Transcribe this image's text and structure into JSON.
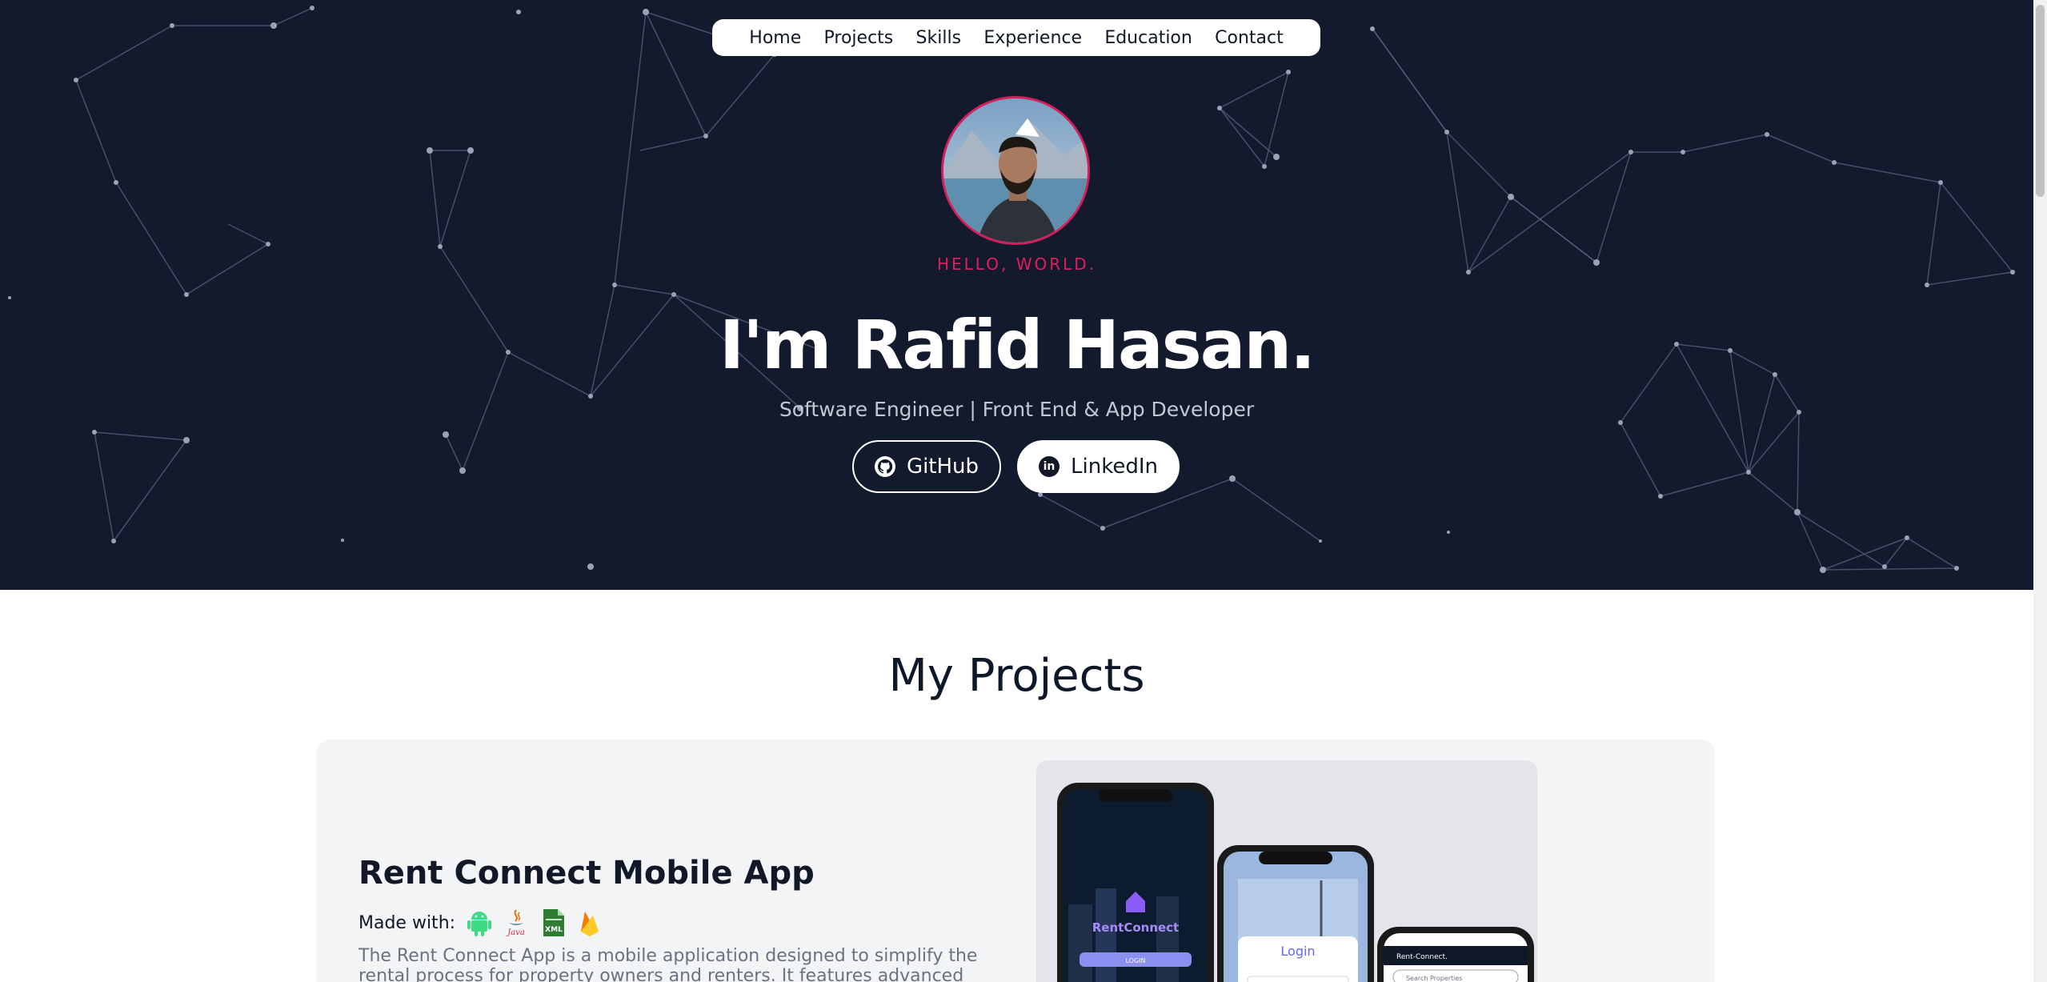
{
  "nav": {
    "items": [
      "Home",
      "Projects",
      "Skills",
      "Experience",
      "Education",
      "Contact"
    ]
  },
  "hero": {
    "greeting": "HELLO, WORLD.",
    "name": "I'm Rafid Hasan.",
    "role": "Software Engineer | Front End & App Developer",
    "github_label": "GitHub",
    "linkedin_label": "LinkedIn"
  },
  "projects": {
    "section_title": "My Projects",
    "items": [
      {
        "title": "Rent Connect Mobile App",
        "made_with_label": "Made with:",
        "tech_icons": [
          "android-icon",
          "java-icon",
          "xml-icon",
          "firebase-icon"
        ],
        "description": "The Rent Connect App is a mobile application designed to simplify the rental process for property owners and renters. It features advanced search filters",
        "mockup": {
          "app_name": "RentConnect",
          "login_label": "LOGIN",
          "login_title": "Login",
          "header": "Rent-Connect.",
          "search_placeholder": "Search Properties"
        }
      }
    ]
  },
  "colors": {
    "hero_bg": "#131a2e",
    "accent": "#e21d5c",
    "card_bg": "#f3f4f6"
  }
}
